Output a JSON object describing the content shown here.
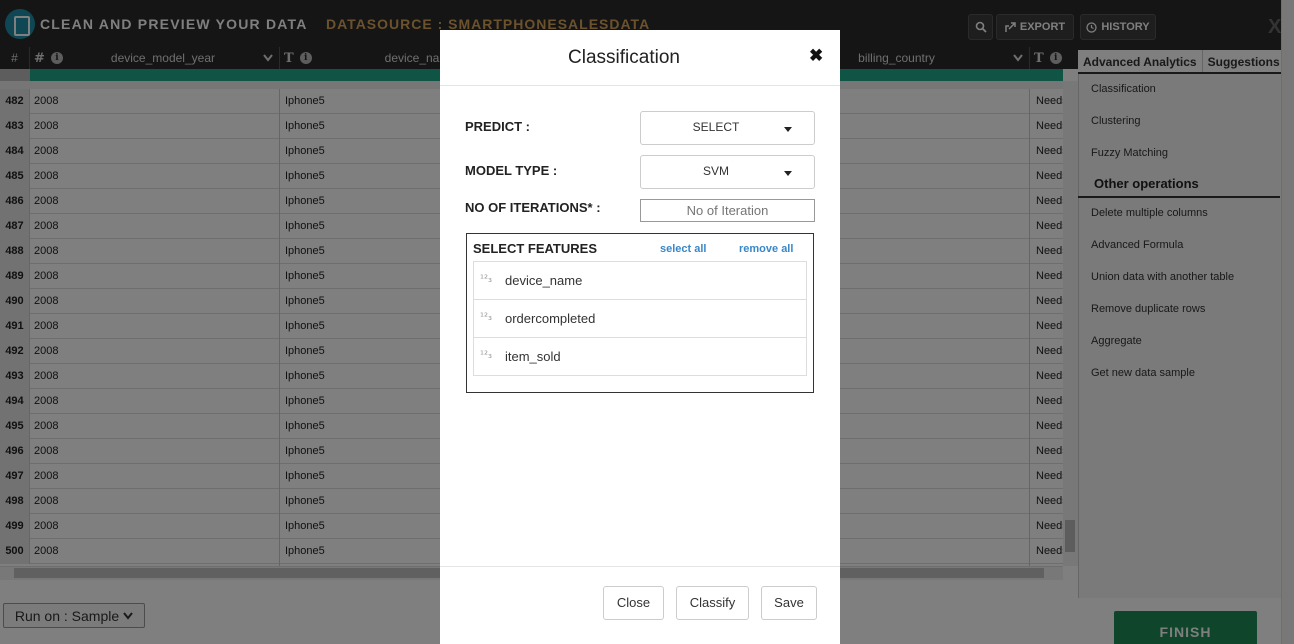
{
  "topbar": {
    "app_title": "CLEAN AND PREVIEW YOUR DATA",
    "datasource_title": "DATASOURCE : SMARTPHONESALESDATA",
    "search_icon": "search-icon",
    "export_label": "EXPORT",
    "history_label": "HISTORY",
    "close_label": "X"
  },
  "grid": {
    "rownum_header": "#",
    "columns": [
      {
        "type": "#",
        "name": "device_model_year"
      },
      {
        "type": "T",
        "name": "device_name"
      },
      {
        "type": "",
        "name": "billing_country"
      },
      {
        "type": "T",
        "name": ""
      }
    ],
    "rows": [
      {
        "num": "482",
        "year": "2008",
        "device": "Iphone5",
        "last": "Needs"
      },
      {
        "num": "483",
        "year": "2008",
        "device": "Iphone5",
        "last": "Needs"
      },
      {
        "num": "484",
        "year": "2008",
        "device": "Iphone5",
        "last": "Needs"
      },
      {
        "num": "485",
        "year": "2008",
        "device": "Iphone5",
        "last": "Needs"
      },
      {
        "num": "486",
        "year": "2008",
        "device": "Iphone5",
        "last": "Needs"
      },
      {
        "num": "487",
        "year": "2008",
        "device": "Iphone5",
        "last": "Needs"
      },
      {
        "num": "488",
        "year": "2008",
        "device": "Iphone5",
        "last": "Needs"
      },
      {
        "num": "489",
        "year": "2008",
        "device": "Iphone5",
        "last": "Needs"
      },
      {
        "num": "490",
        "year": "2008",
        "device": "Iphone5",
        "last": "Needs"
      },
      {
        "num": "491",
        "year": "2008",
        "device": "Iphone5",
        "last": "Needs"
      },
      {
        "num": "492",
        "year": "2008",
        "device": "Iphone5",
        "last": "Needs"
      },
      {
        "num": "493",
        "year": "2008",
        "device": "Iphone5",
        "last": "Needs"
      },
      {
        "num": "494",
        "year": "2008",
        "device": "Iphone5",
        "last": "Needs"
      },
      {
        "num": "495",
        "year": "2008",
        "device": "Iphone5",
        "last": "Needs"
      },
      {
        "num": "496",
        "year": "2008",
        "device": "Iphone5",
        "last": "Needs"
      },
      {
        "num": "497",
        "year": "2008",
        "device": "Iphone5",
        "last": "Needs"
      },
      {
        "num": "498",
        "year": "2008",
        "device": "Iphone5",
        "last": "Needs"
      },
      {
        "num": "499",
        "year": "2008",
        "device": "Iphone5",
        "last": "Needs"
      },
      {
        "num": "500",
        "year": "2008",
        "device": "Iphone5",
        "last": "Needs"
      }
    ]
  },
  "bottom": {
    "run_on_label": "Run on : Sample",
    "finish_label": "FINISH"
  },
  "right_panel": {
    "tabs": [
      "Advanced Analytics",
      "Suggestions"
    ],
    "analytics_items": [
      "Classification",
      "Clustering",
      "Fuzzy Matching"
    ],
    "other_title": "Other operations",
    "other_items": [
      "Delete multiple columns",
      "Advanced Formula",
      "Union data with another table",
      "Remove duplicate rows",
      "Aggregate",
      "Get new data sample"
    ]
  },
  "modal": {
    "title": "Classification",
    "close_glyph": "✖",
    "predict_label": "PREDICT :",
    "predict_value": "SELECT",
    "model_type_label": "MODEL TYPE :",
    "model_type_value": "SVM",
    "iterations_label": "NO OF ITERATIONS* :",
    "iterations_placeholder": "No of Iteration",
    "features_title": "SELECT FEATURES",
    "select_all": "select all",
    "remove_all": "remove all",
    "features": [
      {
        "icon": "numeric-type-icon",
        "label": "device_name"
      },
      {
        "icon": "numeric-type-icon",
        "label": "ordercompleted"
      },
      {
        "icon": "numeric-type-icon",
        "label": "item_sold"
      }
    ],
    "buttons": {
      "close": "Close",
      "classify": "Classify",
      "save": "Save"
    }
  },
  "colors": {
    "topbar_bg": "#2b2b2b",
    "accent_gold": "#d6a55a",
    "teal": "#1fa88a",
    "finish_green": "#1e8a57",
    "link_blue": "#3a87c8"
  }
}
